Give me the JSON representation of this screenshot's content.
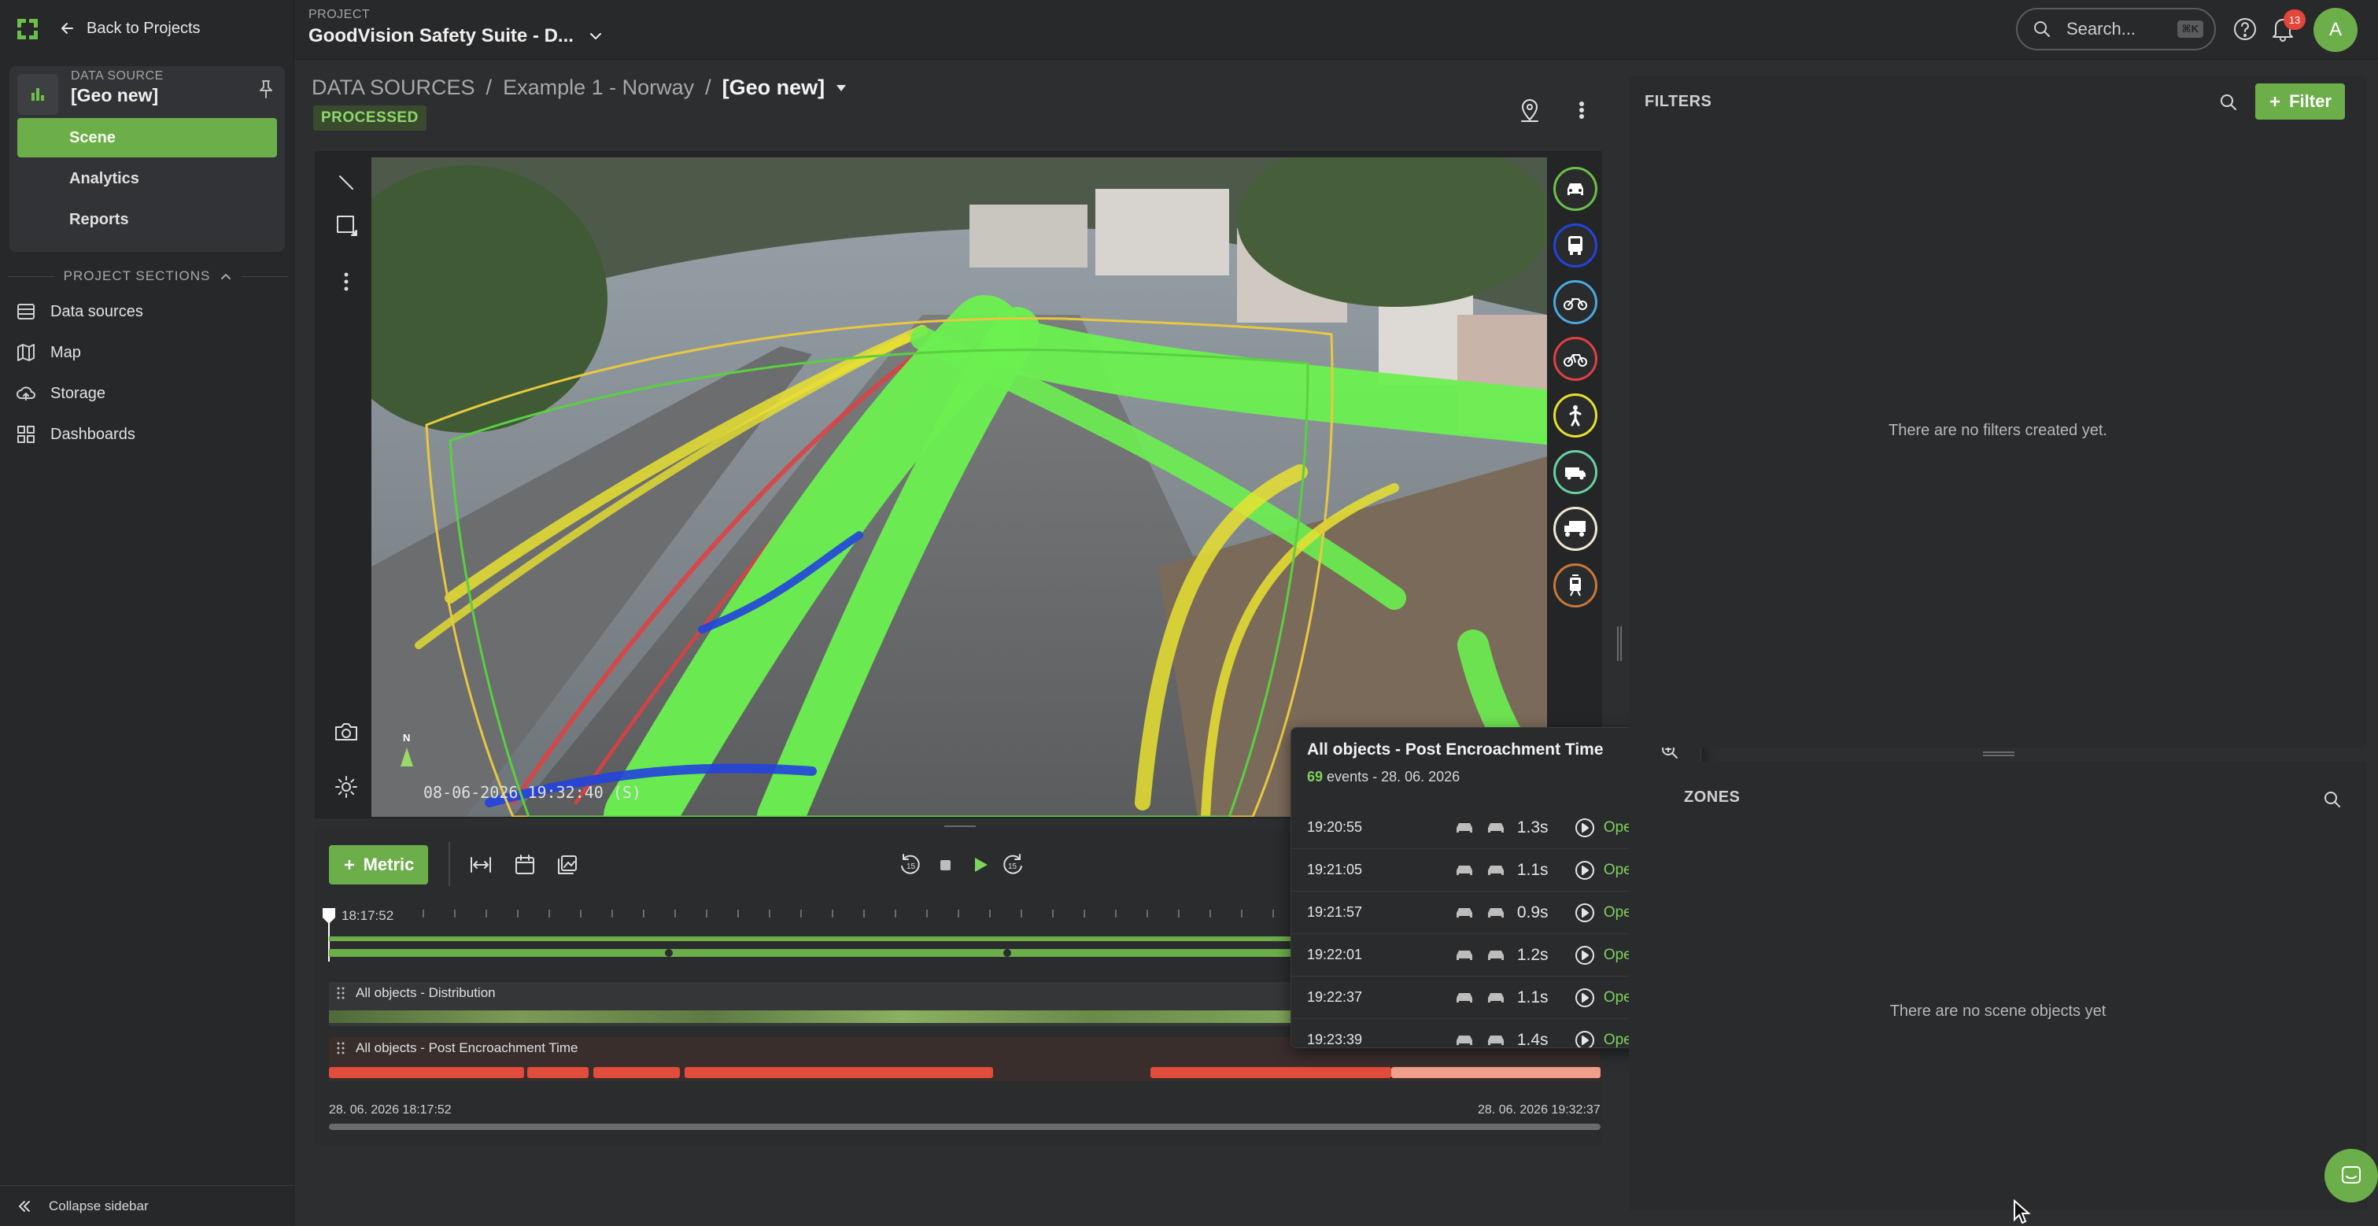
{
  "nav": {
    "back_label": "Back to Projects",
    "data_source_caption": "DATA SOURCE",
    "data_source_name": "[Geo new]",
    "items": [
      {
        "label": "Scene",
        "active": true
      },
      {
        "label": "Analytics",
        "active": false
      },
      {
        "label": "Reports",
        "active": false
      }
    ],
    "sections_label": "PROJECT SECTIONS",
    "sections": [
      {
        "label": "Data sources",
        "icon": "data-sources-icon"
      },
      {
        "label": "Map",
        "icon": "map-icon"
      },
      {
        "label": "Storage",
        "icon": "cloud-upload-icon"
      },
      {
        "label": "Dashboards",
        "icon": "dashboard-grid-icon"
      }
    ],
    "collapse_label": "Collapse sidebar"
  },
  "topbar": {
    "project_caption": "PROJECT",
    "project_name": "GoodVision Safety Suite - D...",
    "search_placeholder": "Search...",
    "search_shortcut": "⌘K",
    "notification_count": "13",
    "avatar_initial": "A"
  },
  "header": {
    "breadcrumb": [
      "DATA SOURCES",
      "Example 1 - Norway",
      "[Geo new]"
    ],
    "separator": "/",
    "status": "PROCESSED"
  },
  "scene": {
    "compass_label": "N",
    "timestamp_overlay": "08-06-2026  19:32:40 (S)",
    "class_filters": [
      {
        "name": "car-icon",
        "color": "#6cc04a"
      },
      {
        "name": "bus-icon",
        "color": "#2244dd"
      },
      {
        "name": "motorbike-icon",
        "color": "#4aa8e0"
      },
      {
        "name": "bicycle-icon",
        "color": "#e04040"
      },
      {
        "name": "pedestrian-icon",
        "color": "#e8e030"
      },
      {
        "name": "van-icon",
        "color": "#6ad0a0"
      },
      {
        "name": "truck-icon",
        "color": "#f0e8d0"
      },
      {
        "name": "tram-icon",
        "color": "#c8783a"
      }
    ]
  },
  "timeline": {
    "metric_label": "Metric",
    "current_time": "18:17:52",
    "start_label": "28. 06. 2026 18:17:52",
    "end_label": "28. 06. 2026 19:32:37",
    "tracks": [
      {
        "label": "All objects - Distribution"
      },
      {
        "label": "All objects - Post Encroachment Time"
      }
    ]
  },
  "popup": {
    "title": "All objects - Post Encroachment Time",
    "event_count": "69",
    "events_suffix": "events - 28. 06. 2026",
    "events": [
      {
        "time": "19:20:55",
        "duration": "1.3s",
        "link": "Open detail"
      },
      {
        "time": "19:21:05",
        "duration": "1.1s",
        "link": "Open detail"
      },
      {
        "time": "19:21:57",
        "duration": "0.9s",
        "link": "Open detail"
      },
      {
        "time": "19:22:01",
        "duration": "1.2s",
        "link": "Open detail"
      },
      {
        "time": "19:22:37",
        "duration": "1.1s",
        "link": "Open detail"
      },
      {
        "time": "19:23:39",
        "duration": "1.4s",
        "link": "Open detail"
      }
    ]
  },
  "filters": {
    "title": "FILTERS",
    "add_label": "Filter",
    "empty": "There are no filters created yet."
  },
  "zones": {
    "title": "ZONES",
    "empty": "There are no scene objects yet"
  },
  "colors": {
    "accent": "#6cae4a",
    "danger": "#e24c3a",
    "background": "#2d2e30"
  }
}
